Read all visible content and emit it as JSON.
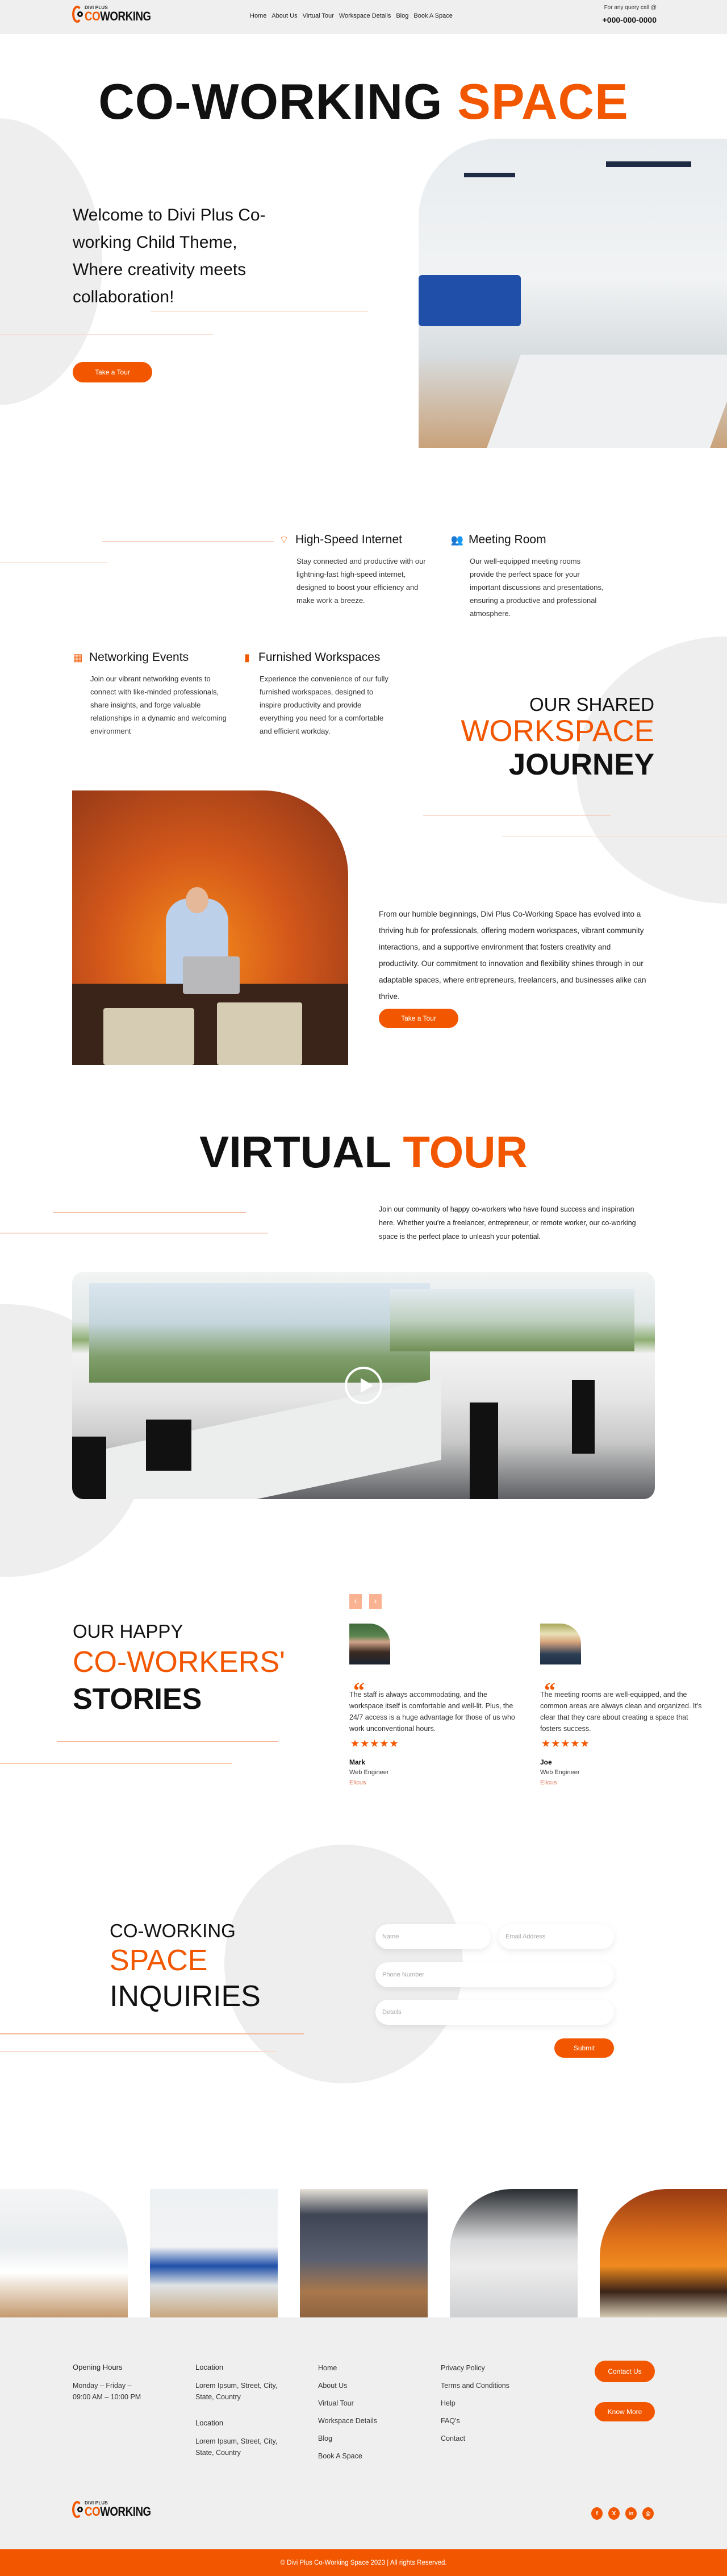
{
  "brand": {
    "logo_small": "DIVI PLUS",
    "logo_co": "CO",
    "logo_rest": "WORKING",
    "accent_color": "#f25700"
  },
  "header": {
    "nav": [
      "Home",
      "About Us",
      "Virtual Tour",
      "Workspace Details",
      "Blog",
      "Book A Space"
    ],
    "query_label": "For any query call @",
    "phone": "+000-000-0000"
  },
  "hero": {
    "title_black": "CO-WORKING",
    "title_orange": "SPACE",
    "subtitle": "Welcome to Divi Plus Co-working Child Theme, Where creativity meets collaboration!",
    "cta": "Take a Tour"
  },
  "features": [
    {
      "icon": "wifi-icon",
      "title": "High-Speed Internet",
      "text": "Stay connected and productive with our lightning-fast high-speed internet, designed to boost your efficiency and make work a breeze."
    },
    {
      "icon": "users-icon",
      "title": "Meeting Room",
      "text": "Our well-equipped meeting rooms provide the perfect space for your important discussions and presentations, ensuring a productive and professional atmosphere."
    },
    {
      "icon": "calendar-icon",
      "title": "Networking Events",
      "text": "Join our vibrant networking events to connect with like-minded professionals, share insights, and forge valuable relationships in a dynamic and welcoming environment"
    },
    {
      "icon": "building-icon",
      "title": "Furnished Workspaces",
      "text": "Experience the convenience of our fully furnished workspaces, designed to inspire productivity and provide everything you need for a comfortable and efficient workday."
    }
  ],
  "journey": {
    "line1": "OUR SHARED",
    "line2": "WORKSPACE",
    "line3": "JOURNEY",
    "text": "From our humble beginnings, Divi Plus Co-Working Space has evolved into a thriving hub for professionals, offering modern workspaces, vibrant community interactions, and a supportive environment that fosters creativity and productivity. Our commitment to innovation and flexibility shines through in our adaptable spaces, where entrepreneurs, freelancers, and businesses alike can thrive.",
    "cta": "Take a Tour"
  },
  "tour": {
    "title_black": "VIRTUAL",
    "title_orange": "TOUR",
    "text": "Join our community of happy co-workers who have found success and inspiration here. Whether you're a freelancer, entrepreneur, or remote worker, our co-working space is the perfect place to unleash your potential."
  },
  "stories": {
    "line1": "OUR HAPPY",
    "line2": "CO-WORKERS'",
    "line3": "STORIES",
    "prev": "‹",
    "next": "›",
    "items": [
      {
        "quote": "The staff is always accommodating, and the workspace itself is comfortable and well-lit. Plus, the 24/7 access is a huge advantage for those of us who work unconventional hours.",
        "rating": 5,
        "stars": "★★★★★",
        "name": "Mark",
        "role": "Web Engineer",
        "company": "Elicus"
      },
      {
        "quote": "The meeting rooms are well-equipped, and the common areas are always clean and organized. It's clear that they care about creating a space that fosters success.",
        "rating": 5,
        "stars": "★★★★★",
        "name": "Joe",
        "role": "Web Engineer",
        "company": "Elicus"
      }
    ]
  },
  "inquiry": {
    "line1": "CO-WORKING",
    "line2": "SPACE",
    "line3": "INQUIRIES",
    "name_placeholder": "Name",
    "email_placeholder": "Email Address",
    "phone_placeholder": "Phone Number",
    "details_placeholder": "Details",
    "submit": "Submit"
  },
  "footer": {
    "hours_title": "Opening Hours",
    "hours_days": "Monday – Friday –",
    "hours_time": "09:00 AM – 10:00 PM",
    "location1_title": "Location",
    "location1_text": "Lorem Ipsum, Street, City, State, Country",
    "location2_title": "Location",
    "location2_text": "Lorem Ipsum, Street, City, State, Country",
    "links1": [
      "Home",
      "About Us",
      "Virtual Tour",
      "Workspace Details",
      "Blog",
      "Book A Space"
    ],
    "links2": [
      "Privacy Policy",
      "Terms and Conditions",
      "Help",
      "FAQ's",
      "Contact"
    ],
    "contact_btn": "Contact Us",
    "know_btn": "Know More",
    "social": [
      {
        "icon": "facebook-icon",
        "glyph": "f"
      },
      {
        "icon": "x-twitter-icon",
        "glyph": "X"
      },
      {
        "icon": "linkedin-icon",
        "glyph": "in"
      },
      {
        "icon": "instagram-icon",
        "glyph": "◎"
      }
    ],
    "copyright": "© Divi Plus Co-Working Space 2023 | All rights Reserved."
  }
}
